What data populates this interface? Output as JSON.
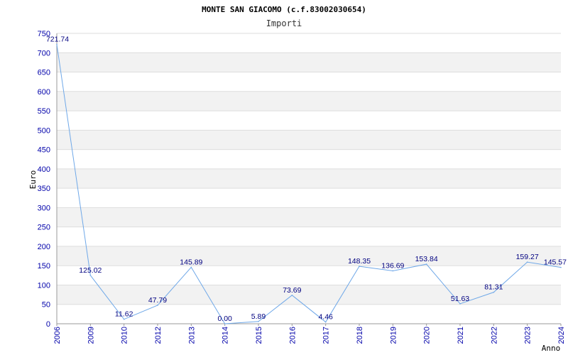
{
  "chart_data": {
    "type": "line",
    "title": "MONTE SAN GIACOMO (c.f.83002030654)",
    "subtitle": "Importi",
    "ylabel": "Euro",
    "xlabel": "Anno",
    "ylim": [
      0,
      750
    ],
    "yticks": [
      0,
      50,
      100,
      150,
      200,
      250,
      300,
      350,
      400,
      450,
      500,
      550,
      600,
      650,
      700,
      750
    ],
    "grid": true,
    "categories": [
      "2006",
      "2009",
      "2010",
      "2012",
      "2013",
      "2014",
      "2015",
      "2016",
      "2017",
      "2018",
      "2019",
      "2020",
      "2021",
      "2022",
      "2023",
      "2024"
    ],
    "series": [
      {
        "values": [
          721.74,
          125.02,
          11.62,
          47.79,
          145.89,
          0.0,
          5.89,
          73.69,
          4.46,
          148.35,
          136.69,
          153.84,
          51.63,
          81.31,
          159.27,
          145.57
        ],
        "labels": [
          "721.74",
          "125.02",
          "11.62",
          "47.79",
          "145.89",
          "0.00",
          "5.89",
          "73.69",
          "4.46",
          "148.35",
          "136.69",
          "153.84",
          "51.63",
          "81.31",
          "159.27",
          "145.57"
        ],
        "color": "#6fa8e8"
      }
    ],
    "colors": {
      "band": "#f2f2f2",
      "gridline": "#dddddd",
      "axis": "#999999",
      "tick_text": "#0000aa",
      "label_text": "#000080"
    }
  }
}
